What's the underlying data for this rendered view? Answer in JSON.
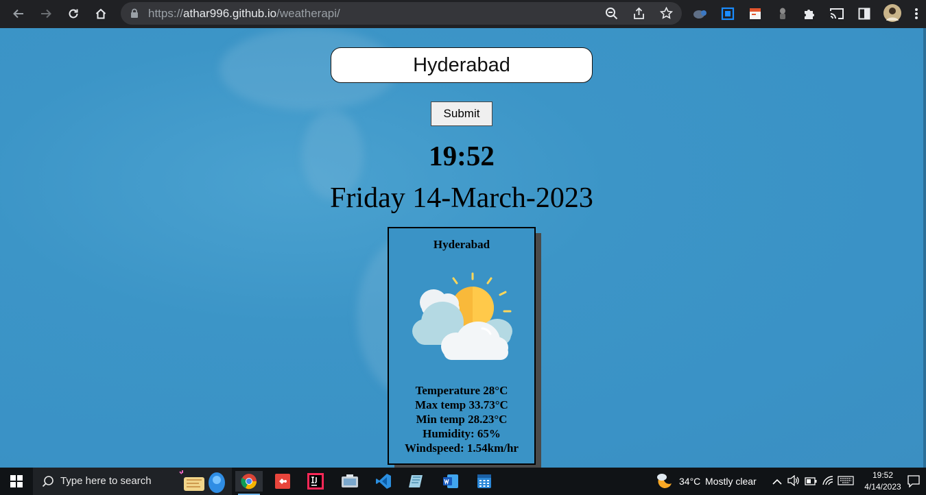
{
  "browser": {
    "url_scheme": "https://",
    "url_host": "athar996.github.io",
    "url_path": "/weatherapi/"
  },
  "app": {
    "city_input_value": "Hyderabad",
    "submit_label": "Submit",
    "time": "19:52",
    "date": "Friday 14-March-2023",
    "card": {
      "city": "Hyderabad",
      "weather_icon": "partly-cloudy-sun-icon",
      "temperature": "Temperature 28°C",
      "max_temp": "Max temp 33.73°C",
      "min_temp": "Min temp 28.23°C",
      "humidity": "Humidity: 65%",
      "windspeed": "Windspeed: 1.54km/hr"
    }
  },
  "taskbar": {
    "search_placeholder": "Type here to search",
    "weather_temp": "34°C",
    "weather_desc": "Mostly clear",
    "clock_time": "19:52",
    "clock_date": "4/14/2023"
  },
  "colors": {
    "page_background": "#3a93c6",
    "chrome_background": "#202124",
    "taskbar_background": "#101316"
  }
}
